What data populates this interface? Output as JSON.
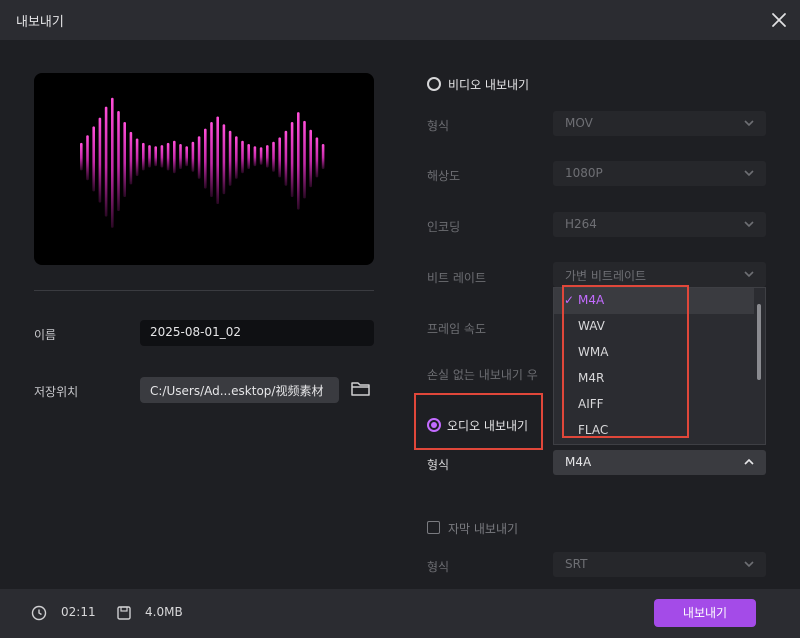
{
  "dialog": {
    "title": "내보내기"
  },
  "name_field": {
    "label": "이름",
    "value": "2025-08-01_02"
  },
  "save_location": {
    "label": "저장위치",
    "value": "C:/Users/Ad...esktop/视频素材"
  },
  "video_export": {
    "label": "비디오 내보내기",
    "selected": false,
    "format": {
      "label": "형식",
      "value": "MOV"
    },
    "resolution": {
      "label": "해상도",
      "value": "1080P"
    },
    "encoding": {
      "label": "인코딩",
      "value": "H264"
    },
    "bitrate": {
      "label": "비트 레이트",
      "value": "가변 비트레이트"
    },
    "frame_rate": {
      "label": "프레임 속도"
    },
    "lossless": {
      "label": "손실 없는 내보내기 우"
    }
  },
  "audio_export": {
    "label": "오디오 내보내기",
    "selected": true,
    "format": {
      "label": "형식",
      "value": "M4A"
    },
    "dropdown": {
      "options": [
        "M4A",
        "WAV",
        "WMA",
        "M4R",
        "AIFF",
        "FLAC"
      ],
      "selected": "M4A"
    }
  },
  "subtitle_export": {
    "label": "자막 내보내기",
    "checked": false,
    "format": {
      "label": "형식",
      "value": "SRT"
    }
  },
  "footer": {
    "duration": "02:11",
    "size": "4.0MB",
    "export_button": "내보내기"
  },
  "colors": {
    "accent": "#a44be8",
    "highlight_box": "#e0473a",
    "waveform": "#e040c8"
  },
  "icons": [
    "close-icon",
    "folder-icon",
    "clock-icon",
    "save-icon",
    "check-icon",
    "chevron-down-icon",
    "chevron-up-icon"
  ]
}
